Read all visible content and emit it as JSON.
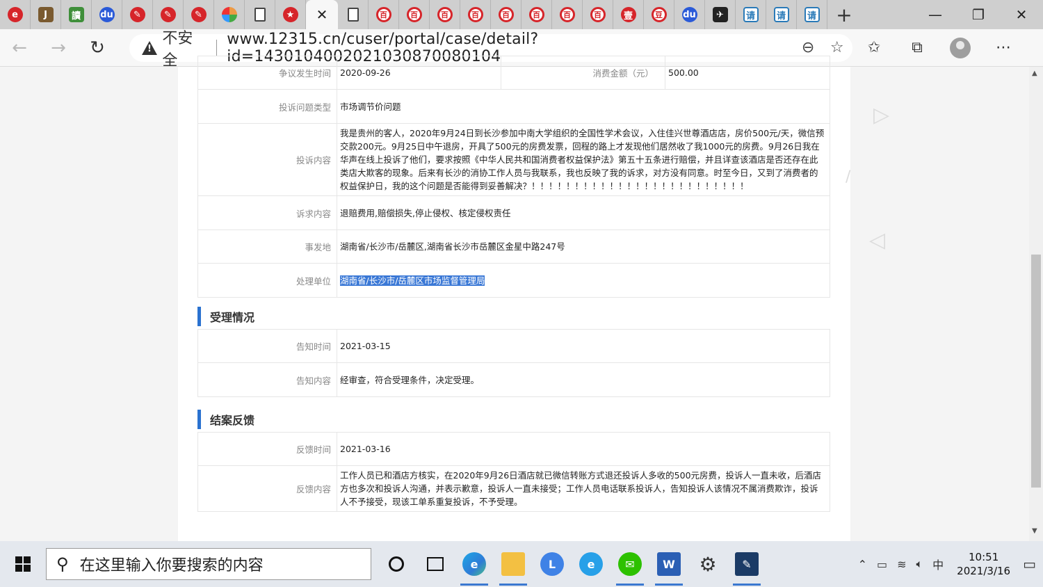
{
  "browser": {
    "tabs": [
      {
        "icon": "cctv-red-icon",
        "glyph": "e"
      },
      {
        "icon": "j-brown-icon",
        "glyph": "J"
      },
      {
        "icon": "reading-green-icon",
        "glyph": "讀"
      },
      {
        "icon": "baidu-paw-icon",
        "glyph": "du"
      },
      {
        "icon": "pen-red-icon",
        "glyph": "✎"
      },
      {
        "icon": "pen-red-icon",
        "glyph": "✎"
      },
      {
        "icon": "pen-red-icon",
        "glyph": "✎"
      },
      {
        "icon": "colorful-ring-icon",
        "glyph": ""
      },
      {
        "icon": "document-icon",
        "glyph": ""
      },
      {
        "icon": "emblem-red-icon",
        "glyph": "★"
      }
    ],
    "active_tab_close": "✕",
    "tabs_after": [
      {
        "icon": "document-icon",
        "glyph": ""
      },
      {
        "icon": "ring-red-icon",
        "glyph": "百"
      },
      {
        "icon": "ring-red-icon",
        "glyph": "百"
      },
      {
        "icon": "ring-red-icon",
        "glyph": "百"
      },
      {
        "icon": "ring-red-icon",
        "glyph": "百"
      },
      {
        "icon": "ring-red-icon",
        "glyph": "百"
      },
      {
        "icon": "ring-red-icon",
        "glyph": "百"
      },
      {
        "icon": "ring-red-icon",
        "glyph": "百"
      },
      {
        "icon": "ring-red-icon",
        "glyph": "百"
      },
      {
        "icon": "red-square-icon",
        "glyph": "壹"
      },
      {
        "icon": "red-outline-icon",
        "glyph": "豆"
      },
      {
        "icon": "baidu-paw-icon",
        "glyph": "du"
      },
      {
        "icon": "bird-dark-icon",
        "glyph": "✈"
      },
      {
        "icon": "qing-teal-icon",
        "glyph": "请"
      },
      {
        "icon": "qing-teal-icon",
        "glyph": "请"
      },
      {
        "icon": "qing-teal-icon",
        "glyph": "请"
      }
    ],
    "new_tab": "+",
    "window_controls": [
      "—",
      "❐",
      "✕"
    ],
    "insecure_label": "不安全",
    "url": "www.12315.cn/cuser/portal/case/detail?id=1430104002021030870080104"
  },
  "case": {
    "top_row": {
      "dispute_date_label": "争议发生时间",
      "dispute_date": "2020-09-26",
      "amount_label": "消费金额（元）",
      "amount": "500.00"
    },
    "rows": [
      {
        "label": "投诉问题类型",
        "value": "市场调节价问题"
      },
      {
        "label": "投诉内容",
        "value": "我是贵州的客人，2020年9月24日到长沙参加中南大学组织的全国性学术会议，入住佳兴世尊酒店店，房价500元/天，微信预交款200元。9月25日中午退房，开具了500元的房费发票，回程的路上才发现他们居然收了我1000元的房费。9月26日我在华声在线上投诉了他们，要求按照《中华人民共和国消费者权益保护法》第五十五条进行赔偿，并且详查该酒店是否还存在此类店大欺客的现象。后来有长沙的消协工作人员与我联系，我也反映了我的诉求，对方没有同意。时至今日，又到了消费者的权益保护日，我的这个问题是否能得到妥善解决？！！！！！！！！！！！！！！！！！！！！！！！！！"
      },
      {
        "label": "诉求内容",
        "value": "退赔费用,赔偿损失,停止侵权、核定侵权责任"
      },
      {
        "label": "事发地",
        "value": "湖南省/长沙市/岳麓区,湖南省长沙市岳麓区金星中路247号"
      },
      {
        "label": "处理单位",
        "value": "湖南省/长沙市/岳麓区市场监督管理局"
      }
    ],
    "acceptance": {
      "title": "受理情况",
      "rows": [
        {
          "label": "告知时间",
          "value": "2021-03-15"
        },
        {
          "label": "告知内容",
          "value": "经审查，符合受理条件，决定受理。"
        }
      ]
    },
    "feedback": {
      "title": "结案反馈",
      "rows": [
        {
          "label": "反馈时间",
          "value": "2021-03-16"
        },
        {
          "label": "反馈内容",
          "value": "工作人员已和酒店方核实，在2020年9月26日酒店就已微信转账方式退还投诉人多收的500元房费，投诉人一直未收，后酒店方也多次和投诉人沟通，并表示歉意，投诉人一直未接受；工作人员电话联系投诉人，告知投诉人该情况不属消费欺诈，投诉人不予接受，现该工单系重复投诉，不予受理。"
        }
      ]
    }
  },
  "taskbar": {
    "search_placeholder": "在这里输入你要搜索的内容",
    "clock_time": "10:51",
    "clock_date": "2021/3/16",
    "ime": "中"
  }
}
